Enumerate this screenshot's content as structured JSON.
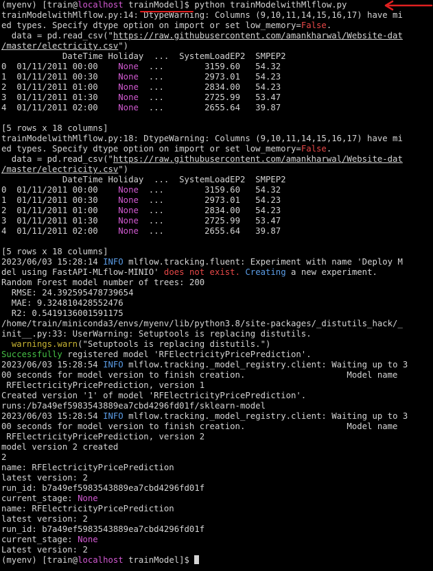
{
  "terminal": {
    "lines": [
      [
        {
          "t": "(myenv) [train@"
        },
        {
          "t": "localhost",
          "c": "magenta"
        },
        {
          "t": " trainModel]$ python trainModelwithMlflow.py"
        }
      ],
      [
        {
          "t": "trainModelwithMlflow.py:14: DtypeWarning: Columns (9,10,11,14,15,16,17) have mi"
        }
      ],
      [
        {
          "t": "ed types. Specify dtype option on import or set low_memory="
        },
        {
          "t": "False",
          "c": "red"
        },
        {
          "t": "."
        }
      ],
      [
        {
          "t": "  data = pd.read_csv(\""
        },
        {
          "t": "https://raw.githubusercontent.com/amankharwal/Website-dat",
          "c": "link"
        }
      ],
      [
        {
          "t": "/master/electricity.csv",
          "c": "link"
        },
        {
          "t": "\")"
        }
      ],
      [
        {
          "t": "            DateTime Holiday  ...  SystemLoadEP2  SMPEP2"
        }
      ],
      [
        {
          "t": "0  01/11/2011 00:00    "
        },
        {
          "t": "None",
          "c": "magenta"
        },
        {
          "t": "  ...        3159.60   54.32"
        }
      ],
      [
        {
          "t": "1  01/11/2011 00:30    "
        },
        {
          "t": "None",
          "c": "magenta"
        },
        {
          "t": "  ...        2973.01   54.23"
        }
      ],
      [
        {
          "t": "2  01/11/2011 01:00    "
        },
        {
          "t": "None",
          "c": "magenta"
        },
        {
          "t": "  ...        2834.00   54.23"
        }
      ],
      [
        {
          "t": "3  01/11/2011 01:30    "
        },
        {
          "t": "None",
          "c": "magenta"
        },
        {
          "t": "  ...        2725.99   53.47"
        }
      ],
      [
        {
          "t": "4  01/11/2011 02:00    "
        },
        {
          "t": "None",
          "c": "magenta"
        },
        {
          "t": "  ...        2655.64   39.87"
        }
      ],
      [
        {
          "t": ""
        }
      ],
      [
        {
          "t": "[5 rows x 18 columns]"
        }
      ],
      [
        {
          "t": "trainModelwithMlflow.py:18: DtypeWarning: Columns (9,10,11,14,15,16,17) have mi"
        }
      ],
      [
        {
          "t": "ed types. Specify dtype option on import or set low_memory="
        },
        {
          "t": "False",
          "c": "red"
        },
        {
          "t": "."
        }
      ],
      [
        {
          "t": "  data = pd.read_csv(\""
        },
        {
          "t": "https://raw.githubusercontent.com/amankharwal/Website-dat",
          "c": "link"
        }
      ],
      [
        {
          "t": "/master/electricity.csv",
          "c": "link"
        },
        {
          "t": "\")"
        }
      ],
      [
        {
          "t": "            DateTime Holiday  ...  SystemLoadEP2  SMPEP2"
        }
      ],
      [
        {
          "t": "0  01/11/2011 00:00    "
        },
        {
          "t": "None",
          "c": "magenta"
        },
        {
          "t": "  ...        3159.60   54.32"
        }
      ],
      [
        {
          "t": "1  01/11/2011 00:30    "
        },
        {
          "t": "None",
          "c": "magenta"
        },
        {
          "t": "  ...        2973.01   54.23"
        }
      ],
      [
        {
          "t": "2  01/11/2011 01:00    "
        },
        {
          "t": "None",
          "c": "magenta"
        },
        {
          "t": "  ...        2834.00   54.23"
        }
      ],
      [
        {
          "t": "3  01/11/2011 01:30    "
        },
        {
          "t": "None",
          "c": "magenta"
        },
        {
          "t": "  ...        2725.99   53.47"
        }
      ],
      [
        {
          "t": "4  01/11/2011 02:00    "
        },
        {
          "t": "None",
          "c": "magenta"
        },
        {
          "t": "  ...        2655.64   39.87"
        }
      ],
      [
        {
          "t": ""
        }
      ],
      [
        {
          "t": "[5 rows x 18 columns]"
        }
      ],
      [
        {
          "t": "2023/06/03 15:28:14 "
        },
        {
          "t": "INFO",
          "c": "blue"
        },
        {
          "t": " mlflow.tracking.fluent: Experiment with name 'Deploy M"
        }
      ],
      [
        {
          "t": "del using FastAPI-MLflow-MINIO' "
        },
        {
          "t": "does not exist.",
          "c": "red"
        },
        {
          "t": " "
        },
        {
          "t": "Creating",
          "c": "blue"
        },
        {
          "t": " a new experiment."
        }
      ],
      [
        {
          "t": "Random Forest model number of trees: 200"
        }
      ],
      [
        {
          "t": "  RMSE: 24.392595478739654"
        }
      ],
      [
        {
          "t": "  MAE: 9.324810428552476"
        }
      ],
      [
        {
          "t": "  R2: 0.5419136001591175"
        }
      ],
      [
        {
          "t": "/home/train/miniconda3/envs/myenv/lib/python3.8/site-packages/_distutils_hack/_"
        }
      ],
      [
        {
          "t": "init__.py:33: UserWarning: Setuptools is replacing distutils."
        }
      ],
      [
        {
          "t": "  "
        },
        {
          "t": "warnings.warn",
          "c": "yellow"
        },
        {
          "t": "(\"Setuptools is replacing distutils.\")"
        }
      ],
      [
        {
          "t": "Successfully",
          "c": "green"
        },
        {
          "t": " registered model 'RFElectricityPricePrediction'."
        }
      ],
      [
        {
          "t": "2023/06/03 15:28:54 "
        },
        {
          "t": "INFO",
          "c": "blue"
        },
        {
          "t": " mlflow.tracking._model_registry.client: Waiting up to 3"
        }
      ],
      [
        {
          "t": "00 seconds for model version to finish creation.                    Model name"
        }
      ],
      [
        {
          "t": " RFElectricityPricePrediction, version 1"
        }
      ],
      [
        {
          "t": "Created version '1' of model 'RFElectricityPricePrediction'."
        }
      ],
      [
        {
          "t": "runs:/b7a49ef5983543889ea7cbd4296fd01f/sklearn-model"
        }
      ],
      [
        {
          "t": "2023/06/03 15:28:54 "
        },
        {
          "t": "INFO",
          "c": "blue"
        },
        {
          "t": " mlflow.tracking._model_registry.client: Waiting up to 3"
        }
      ],
      [
        {
          "t": "00 seconds for model version to finish creation.                    Model name"
        }
      ],
      [
        {
          "t": " RFElectricityPricePrediction, version 2"
        }
      ],
      [
        {
          "t": "model version 2 created"
        }
      ],
      [
        {
          "t": "2"
        }
      ],
      [
        {
          "t": "name: RFElectricityPricePrediction"
        }
      ],
      [
        {
          "t": "latest version: 2"
        }
      ],
      [
        {
          "t": "run_id: b7a49ef5983543889ea7cbd4296fd01f"
        }
      ],
      [
        {
          "t": "current_stage: "
        },
        {
          "t": "None",
          "c": "magenta"
        }
      ],
      [
        {
          "t": "name: RFElectricityPricePrediction"
        }
      ],
      [
        {
          "t": "latest version: 2"
        }
      ],
      [
        {
          "t": "run_id: b7a49ef5983543889ea7cbd4296fd01f"
        }
      ],
      [
        {
          "t": "current_stage: "
        },
        {
          "t": "None",
          "c": "magenta"
        }
      ],
      [
        {
          "t": "Latest version: 2"
        }
      ],
      [
        {
          "t": "(myenv) [train@"
        },
        {
          "t": "localhost",
          "c": "magenta"
        },
        {
          "t": " trainModel]$ "
        }
      ]
    ]
  },
  "colors": {
    "background": "#000000",
    "foreground": "#d4d4d4",
    "magenta": "#d25ad2",
    "red": "#e84848",
    "blue": "#5c9ee8",
    "green": "#46c246",
    "yellow": "#c8b432",
    "annotation": "#e02020"
  },
  "icons": {
    "cursor": "block-cursor",
    "annotation_arrow": "red-arrow-icon"
  }
}
